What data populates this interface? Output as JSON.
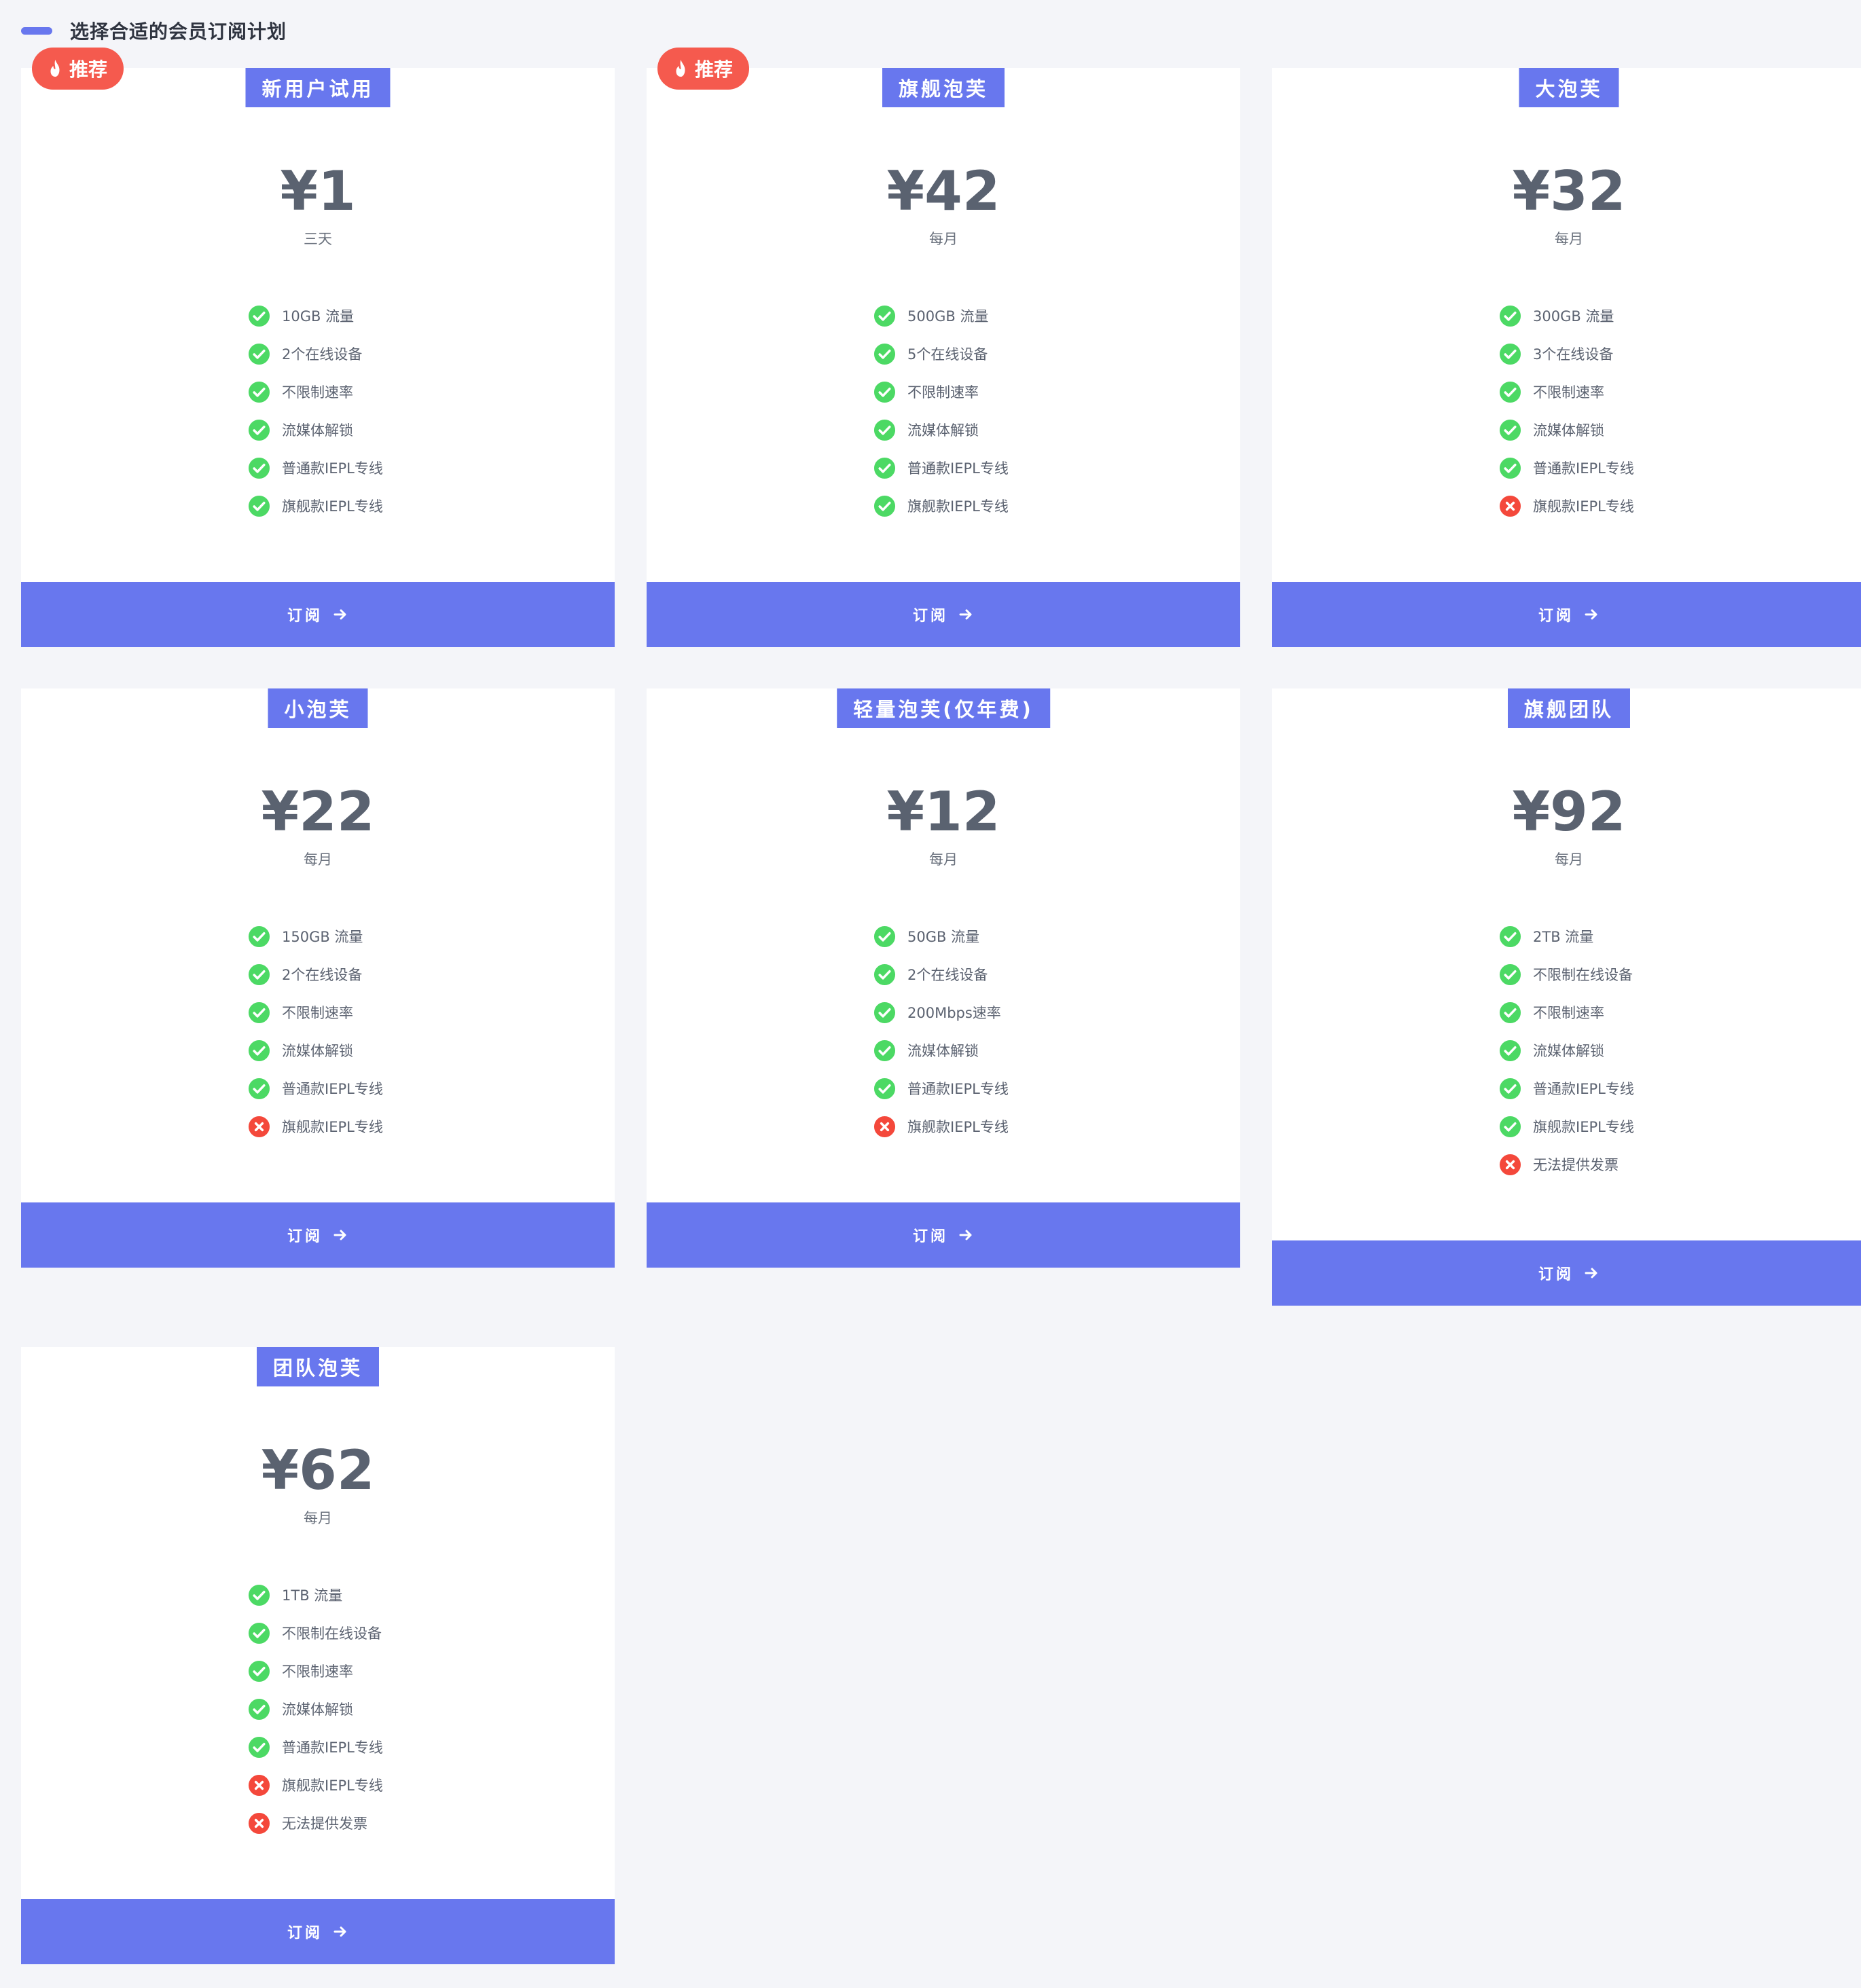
{
  "header": {
    "title": "选择合适的会员订阅计划"
  },
  "colors": {
    "accent": "#6877ee",
    "badge": "#f55a4e",
    "included": "#4cd964",
    "excluded": "#f4483b",
    "background": "#f4f5f9"
  },
  "plans": [
    {
      "name": "新用户试用",
      "price": "¥1",
      "period": "三天",
      "badge": "推荐",
      "subscribe_label": "订阅",
      "features": [
        {
          "text": "10GB 流量",
          "included": true
        },
        {
          "text": "2个在线设备",
          "included": true
        },
        {
          "text": "不限制速率",
          "included": true
        },
        {
          "text": "流媒体解锁",
          "included": true
        },
        {
          "text": "普通款IEPL专线",
          "included": true
        },
        {
          "text": "旗舰款IEPL专线",
          "included": true
        }
      ]
    },
    {
      "name": "旗舰泡芙",
      "price": "¥42",
      "period": "每月",
      "badge": "推荐",
      "subscribe_label": "订阅",
      "features": [
        {
          "text": "500GB 流量",
          "included": true
        },
        {
          "text": "5个在线设备",
          "included": true
        },
        {
          "text": "不限制速率",
          "included": true
        },
        {
          "text": "流媒体解锁",
          "included": true
        },
        {
          "text": "普通款IEPL专线",
          "included": true
        },
        {
          "text": "旗舰款IEPL专线",
          "included": true
        }
      ]
    },
    {
      "name": "大泡芙",
      "price": "¥32",
      "period": "每月",
      "subscribe_label": "订阅",
      "features": [
        {
          "text": "300GB 流量",
          "included": true
        },
        {
          "text": "3个在线设备",
          "included": true
        },
        {
          "text": "不限制速率",
          "included": true
        },
        {
          "text": "流媒体解锁",
          "included": true
        },
        {
          "text": "普通款IEPL专线",
          "included": true
        },
        {
          "text": "旗舰款IEPL专线",
          "included": false
        }
      ]
    },
    {
      "name": "小泡芙",
      "price": "¥22",
      "period": "每月",
      "subscribe_label": "订阅",
      "features": [
        {
          "text": "150GB 流量",
          "included": true
        },
        {
          "text": "2个在线设备",
          "included": true
        },
        {
          "text": "不限制速率",
          "included": true
        },
        {
          "text": "流媒体解锁",
          "included": true
        },
        {
          "text": "普通款IEPL专线",
          "included": true
        },
        {
          "text": "旗舰款IEPL专线",
          "included": false
        }
      ]
    },
    {
      "name": "轻量泡芙(仅年费)",
      "price": "¥12",
      "period": "每月",
      "subscribe_label": "订阅",
      "features": [
        {
          "text": "50GB 流量",
          "included": true
        },
        {
          "text": "2个在线设备",
          "included": true
        },
        {
          "text": "200Mbps速率",
          "included": true
        },
        {
          "text": "流媒体解锁",
          "included": true
        },
        {
          "text": "普通款IEPL专线",
          "included": true
        },
        {
          "text": "旗舰款IEPL专线",
          "included": false
        }
      ]
    },
    {
      "name": "旗舰团队",
      "price": "¥92",
      "period": "每月",
      "subscribe_label": "订阅",
      "features": [
        {
          "text": "2TB 流量",
          "included": true
        },
        {
          "text": "不限制在线设备",
          "included": true
        },
        {
          "text": "不限制速率",
          "included": true
        },
        {
          "text": "流媒体解锁",
          "included": true
        },
        {
          "text": "普通款IEPL专线",
          "included": true
        },
        {
          "text": "旗舰款IEPL专线",
          "included": true
        },
        {
          "text": "无法提供发票",
          "included": false
        }
      ]
    },
    {
      "name": "团队泡芙",
      "price": "¥62",
      "period": "每月",
      "subscribe_label": "订阅",
      "features": [
        {
          "text": "1TB 流量",
          "included": true
        },
        {
          "text": "不限制在线设备",
          "included": true
        },
        {
          "text": "不限制速率",
          "included": true
        },
        {
          "text": "流媒体解锁",
          "included": true
        },
        {
          "text": "普通款IEPL专线",
          "included": true
        },
        {
          "text": "旗舰款IEPL专线",
          "included": false
        },
        {
          "text": "无法提供发票",
          "included": false
        }
      ]
    }
  ]
}
